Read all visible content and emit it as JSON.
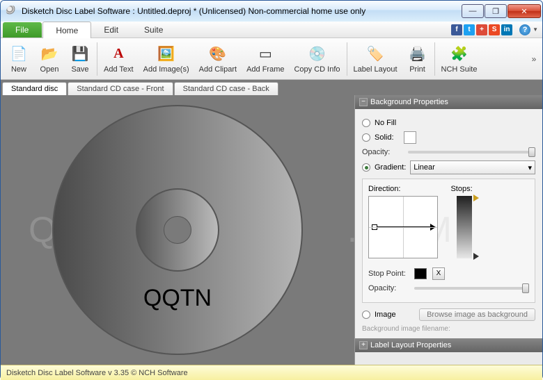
{
  "window": {
    "title": "Disketch Disc Label Software : Untitled.deproj * (Unlicensed) Non-commercial home use only"
  },
  "menu": {
    "file": "File",
    "home": "Home",
    "edit": "Edit",
    "suite": "Suite"
  },
  "toolbar": {
    "new": "New",
    "open": "Open",
    "save": "Save",
    "add_text": "Add Text",
    "add_images": "Add Image(s)",
    "add_clipart": "Add Clipart",
    "add_frame": "Add Frame",
    "copy_cd_info": "Copy CD Info",
    "label_layout": "Label Layout",
    "print": "Print",
    "nch_suite": "NCH Suite"
  },
  "tabs": {
    "t1": "Standard disc",
    "t2": "Standard CD case - Front",
    "t3": "Standard CD case - Back"
  },
  "canvas": {
    "disc_text": "QQTN"
  },
  "panel_bg": {
    "title": "Background Properties",
    "no_fill": "No Fill",
    "solid": "Solid:",
    "opacity": "Opacity:",
    "gradient": "Gradient:",
    "gradient_type": "Linear",
    "direction": "Direction:",
    "stops": "Stops:",
    "stop_point": "Stop Point:",
    "x_btn": "X",
    "image": "Image",
    "browse": "Browse image as background",
    "hint": "Background image filename:"
  },
  "panel_layout": {
    "title": "Label Layout Properties"
  },
  "status": {
    "text": "Disketch Disc Label Software v 3.35 © NCH Software"
  },
  "colors": {
    "fb": "#3b5998",
    "tw": "#1da1f2",
    "gp": "#dd4b39",
    "su": "#eb4924",
    "in": "#0077b5"
  }
}
